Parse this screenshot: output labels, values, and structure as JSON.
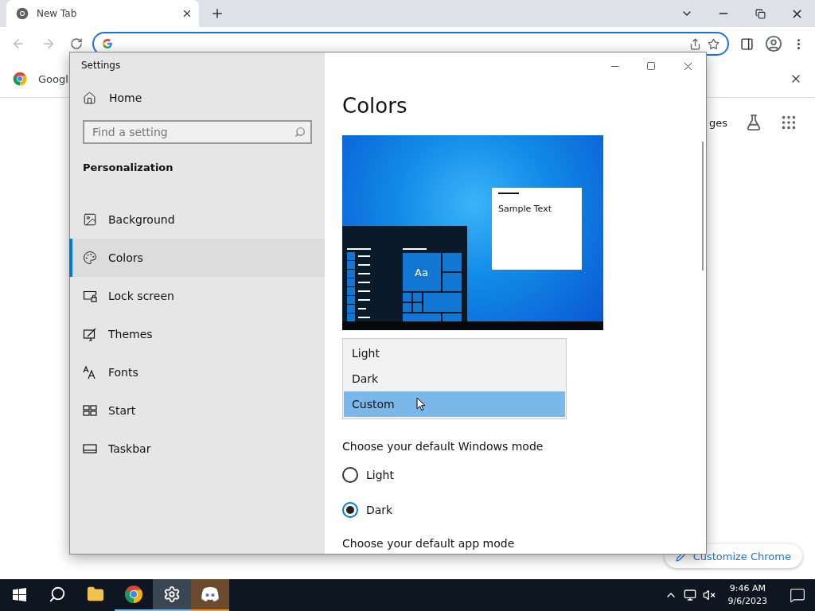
{
  "browser": {
    "tab": {
      "title": "New Tab"
    },
    "infobar": {
      "text": "Googl"
    },
    "page": {
      "link": "ges",
      "customize_button": "Customize Chrome"
    }
  },
  "settings_window": {
    "title": "Settings",
    "home": "Home",
    "search": {
      "placeholder": "Find a setting"
    },
    "section": "Personalization",
    "nav": [
      {
        "kind": "background",
        "label": "Background",
        "selected": false
      },
      {
        "kind": "colors",
        "label": "Colors",
        "selected": true
      },
      {
        "kind": "lock",
        "label": "Lock screen",
        "selected": false
      },
      {
        "kind": "themes",
        "label": "Themes",
        "selected": false
      },
      {
        "kind": "fonts",
        "label": "Fonts",
        "selected": false
      },
      {
        "kind": "start",
        "label": "Start",
        "selected": false
      },
      {
        "kind": "taskbar",
        "label": "Taskbar",
        "selected": false
      }
    ],
    "heading": "Colors",
    "preview": {
      "sample_text": "Sample Text",
      "tile_text": "Aa"
    },
    "dropdown": {
      "options": [
        {
          "label": "Light",
          "selected": false
        },
        {
          "label": "Dark",
          "selected": false
        },
        {
          "label": "Custom",
          "selected": true
        }
      ]
    },
    "windows_mode": {
      "label": "Choose your default Windows mode",
      "options": [
        {
          "label": "Light",
          "selected": false
        },
        {
          "label": "Dark",
          "selected": true
        }
      ]
    },
    "app_mode": {
      "label": "Choose your default app mode"
    }
  },
  "taskbar": {
    "apps": [
      {
        "kind": "explorer",
        "running": false,
        "selected": false,
        "flashing": false
      },
      {
        "kind": "browser",
        "running": true,
        "selected": false,
        "flashing": false
      },
      {
        "kind": "settings",
        "running": true,
        "selected": true,
        "flashing": false
      },
      {
        "kind": "chat",
        "running": true,
        "selected": false,
        "flashing": true
      }
    ],
    "clock": {
      "time": "9:46 AM",
      "date": "9/6/2023"
    }
  }
}
